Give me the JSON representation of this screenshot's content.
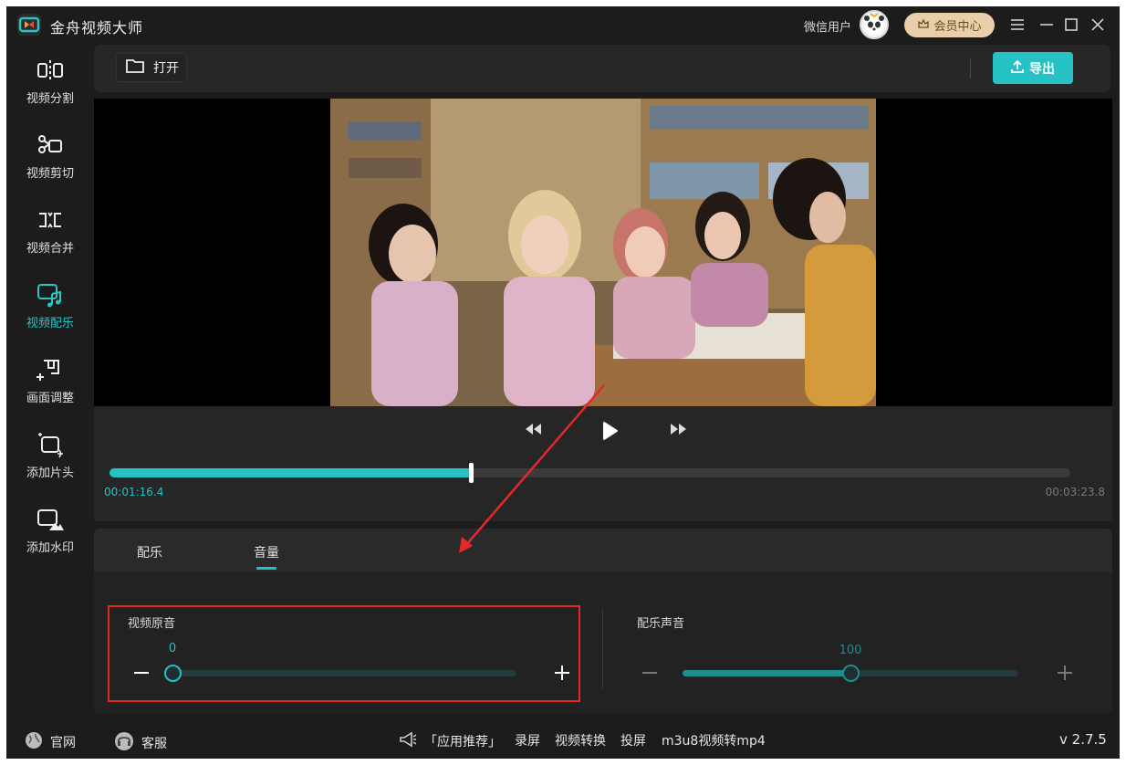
{
  "app": {
    "title": "金舟视频大师"
  },
  "header": {
    "user_name": "微信用户",
    "vip_label": "会员中心"
  },
  "sidebar": {
    "items": [
      {
        "label": "视频分割",
        "icon": "split-icon",
        "active": false
      },
      {
        "label": "视频剪切",
        "icon": "scissors-icon",
        "active": false
      },
      {
        "label": "视频合并",
        "icon": "merge-icon",
        "active": false
      },
      {
        "label": "视频配乐",
        "icon": "music-icon",
        "active": true
      },
      {
        "label": "画面调整",
        "icon": "crop-icon",
        "active": false
      },
      {
        "label": "添加片头",
        "icon": "add-intro-icon",
        "active": false
      },
      {
        "label": "添加水印",
        "icon": "watermark-icon",
        "active": false
      }
    ]
  },
  "toolbar": {
    "open_label": "打开",
    "export_label": "导出"
  },
  "player": {
    "current_time": "00:01:16.4",
    "total_time": "00:03:23.8",
    "progress": 0.376
  },
  "panel": {
    "tabs": [
      {
        "label": "配乐",
        "active": false
      },
      {
        "label": "音量",
        "active": true
      }
    ],
    "original_audio": {
      "label": "视频原音",
      "value": "0",
      "level": 0.0
    },
    "music_audio": {
      "label": "配乐声音",
      "value": "100",
      "level": 0.5
    }
  },
  "statusbar": {
    "website": "官网",
    "support": "客服",
    "recommend": "「应用推荐」",
    "links": [
      "录屏",
      "视频转换",
      "投屏",
      "m3u8视频转mp4"
    ],
    "version": "v 2.7.5"
  },
  "colors": {
    "accent": "#26c1c4",
    "annotation": "#e4282a",
    "vip": "#e9cfa9"
  }
}
